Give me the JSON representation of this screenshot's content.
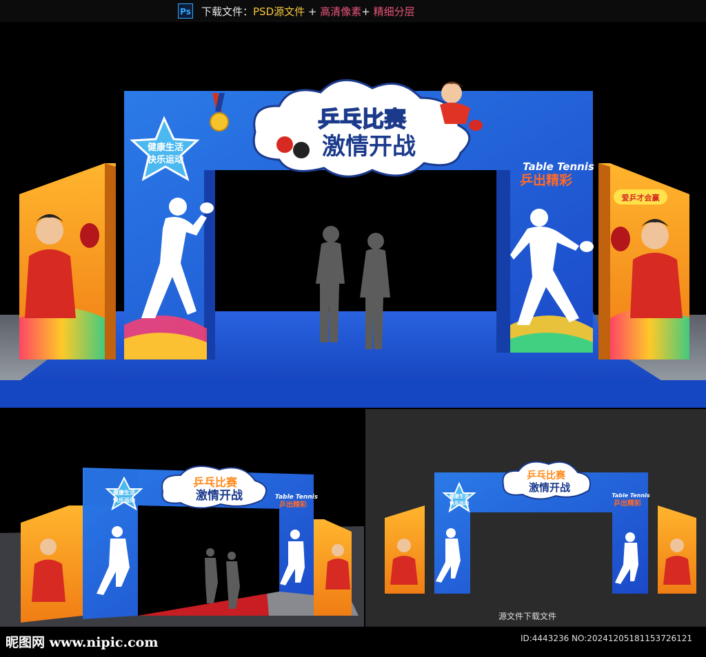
{
  "topbar": {
    "ps_label": "Ps",
    "download_label": "下载文件：",
    "psd_source": "PSD源文件",
    "plus1": " + ",
    "hd_pixels": "高清像素",
    "plus2": "+ ",
    "fine_layers": "精细分层"
  },
  "arch": {
    "title_line1": "乒乓比赛",
    "title_line2": "激情开战",
    "star_line1": "健康生活",
    "star_line2": "快乐运动",
    "en_label": "Table Tennis",
    "cn_label": "乒出精彩",
    "side_badge": "爱乒才会赢"
  },
  "bottom_right": {
    "caption": "源文件下载文件"
  },
  "footer": {
    "watermark": "昵图网 www.nipic.com",
    "id_line": "ID:4443236 NO:20241205181153726121"
  },
  "colors": {
    "arch_blue": "#1f5fd8",
    "orange_panel": "#f29a1f",
    "floor_blue": "#1a4fcf",
    "title_orange": "#ff8a1c",
    "carpet_red": "#c81d22"
  }
}
